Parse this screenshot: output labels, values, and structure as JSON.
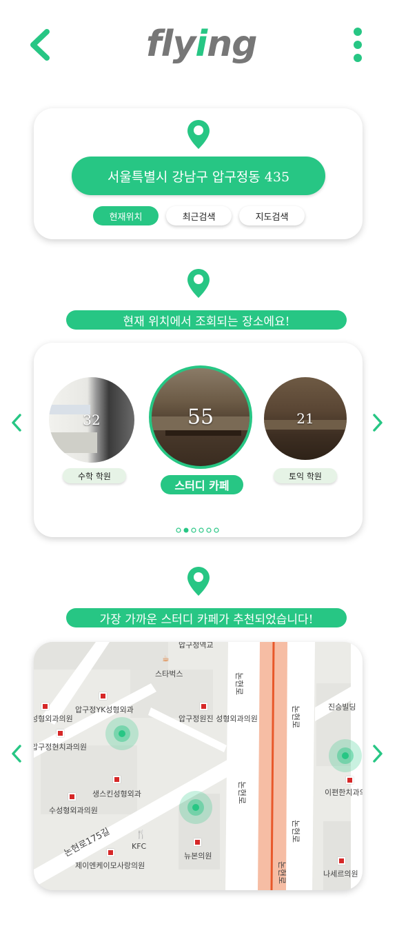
{
  "header": {
    "logo_text_1": "fly",
    "logo_text_2": "i",
    "logo_text_3": "ng"
  },
  "location_card": {
    "address": "서울특별시 강남구 압구정동 435",
    "tabs": [
      "현재위치",
      "최근검색",
      "지도검색"
    ]
  },
  "places_section": {
    "banner": "현재 위치에서 조회되는 장소에요!",
    "places": [
      {
        "name": "수학 학원",
        "count": "32"
      },
      {
        "name": "스터디 카페",
        "count": "55"
      },
      {
        "name": "토익 학원",
        "count": "21"
      }
    ],
    "page_dots": 6,
    "active_dot": 1
  },
  "map_section": {
    "banner": "가장 가까운 스터디 카페가 추천되었습니다!",
    "labels": {
      "l1": "압구정역교",
      "l2": "스타벅스",
      "l3": "압구정YK성형외과",
      "l4": "압구정원진 성형외과의원",
      "l5": "성형외과의원",
      "l6": "압구정현치과의원",
      "l7": "생스킨성형외과",
      "l8": "수성형외과의원",
      "l9": "논현로175길",
      "l10": "KFC",
      "l11": "제이엔케이모사랑의원",
      "l12": "뉴본의원",
      "l13": "진승빌딩",
      "l14": "이편한치과의",
      "l15": "나세르의원",
      "road1": "논현로",
      "road2": "논현로",
      "road3": "논현로",
      "road4": "논현로",
      "road5": "논현로"
    }
  },
  "colors": {
    "accent": "#27c684",
    "logo_gray": "#777777"
  }
}
